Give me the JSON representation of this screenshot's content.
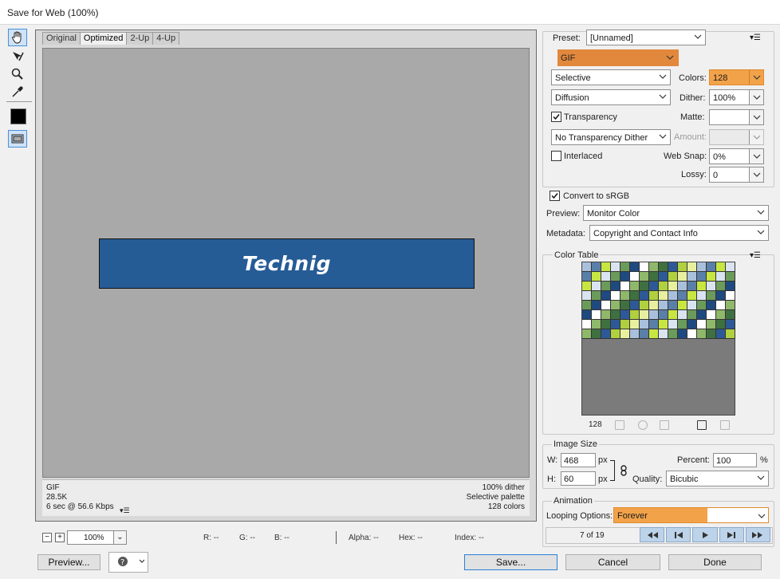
{
  "window": {
    "title": "Save for Web (100%)"
  },
  "tools": [
    {
      "name": "hand-tool",
      "icon": "hand-icon",
      "active": true
    },
    {
      "name": "slice-select-tool",
      "icon": "slice-select-icon",
      "active": false
    },
    {
      "name": "zoom-tool",
      "icon": "zoom-icon",
      "active": false
    },
    {
      "name": "eyedropper-tool",
      "icon": "eyedropper-icon",
      "active": false
    }
  ],
  "eyedropper_color": "#000000",
  "view_tabs": [
    {
      "label": "Original",
      "active": false
    },
    {
      "label": "Optimized",
      "active": true
    },
    {
      "label": "2-Up",
      "active": false
    },
    {
      "label": "4-Up",
      "active": false
    }
  ],
  "canvas": {
    "background": "#a9a9a9",
    "banner_text": "Technig",
    "banner_color": "#265c96"
  },
  "image_info": {
    "format": "GIF",
    "size": "28.5K",
    "download": "6 sec @ 56.6 Kbps",
    "dither": "100% dither",
    "palette": "Selective palette",
    "colors": "128 colors"
  },
  "status_bar": {
    "zoom": "100%",
    "r": "R: --",
    "g": "G: --",
    "b": "B: --",
    "alpha": "Alpha: --",
    "hex": "Hex: --",
    "index": "Index: --"
  },
  "settings": {
    "preset_label": "Preset:",
    "preset_value": "[Unnamed]",
    "format_value": "GIF",
    "reduction_value": "Selective",
    "colors_label": "Colors:",
    "colors_value": "128",
    "dither_algo_value": "Diffusion",
    "dither_label": "Dither:",
    "dither_value": "100%",
    "transparency_label": "Transparency",
    "transparency_checked": true,
    "matte_label": "Matte:",
    "matte_value": "",
    "transparency_dither_value": "No Transparency Dither",
    "amount_label": "Amount:",
    "amount_value": "",
    "interlaced_label": "Interlaced",
    "interlaced_checked": false,
    "websnap_label": "Web Snap:",
    "websnap_value": "0%",
    "lossy_label": "Lossy:",
    "lossy_value": "0",
    "srgb_label": "Convert to sRGB",
    "srgb_checked": true,
    "preview_label": "Preview:",
    "preview_value": "Monitor Color",
    "metadata_label": "Metadata:",
    "metadata_value": "Copyright and Contact Info"
  },
  "color_table": {
    "title": "Color Table",
    "count": "128",
    "palette": [
      "#a9c0dd",
      "#8fb86a",
      "#c8e641",
      "#2d5a96",
      "#6b9b5a",
      "#e8f0a0",
      "#ffffff",
      "#5a7fa8",
      "#3f7040",
      "#d9e4f0",
      "#b0d040",
      "#1f4a80"
    ]
  },
  "image_size": {
    "title": "Image Size",
    "w_label": "W:",
    "w_value": "468",
    "h_label": "H:",
    "h_value": "60",
    "unit": "px",
    "percent_label": "Percent:",
    "percent_value": "100",
    "percent_unit": "%",
    "quality_label": "Quality:",
    "quality_value": "Bicubic"
  },
  "animation": {
    "title": "Animation",
    "looping_label": "Looping Options:",
    "looping_value": "Forever",
    "frame_label": "7 of 19"
  },
  "buttons": {
    "preview": "Preview...",
    "save": "Save...",
    "cancel": "Cancel",
    "done": "Done"
  },
  "colors": {
    "highlight": "#f2a34a",
    "format_highlight": "#e2883c",
    "accent": "#2a7fd4"
  }
}
